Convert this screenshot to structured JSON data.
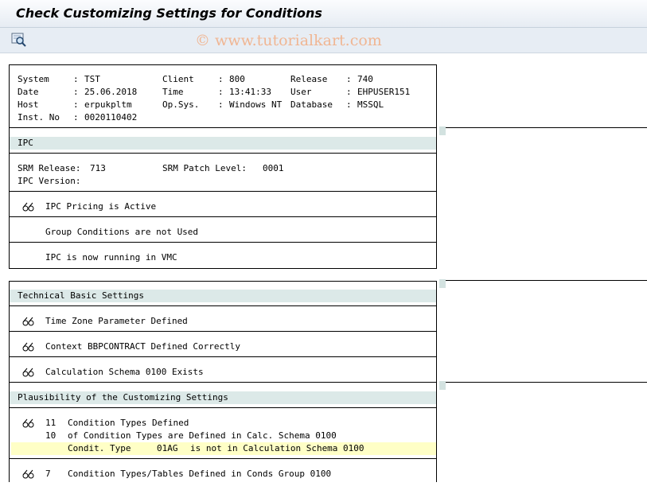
{
  "window": {
    "title": "Check Customizing Settings for Conditions",
    "watermark": "© www.tutorialkart.com"
  },
  "toolbar": {
    "inspect_icon": "magnifier-icon"
  },
  "system_info": {
    "system_label": "System",
    "system_value": "TST",
    "client_label": "Client",
    "client_value": "800",
    "release_label": "Release",
    "release_value": "740",
    "date_label": "Date",
    "date_value": "25.06.2018",
    "time_label": "Time",
    "time_value": "13:41:33",
    "user_label": "User",
    "user_value": "EHPUSER151",
    "host_label": "Host",
    "host_value": "erpukpltm",
    "opsys_label": "Op.Sys.",
    "opsys_value": "Windows NT",
    "database_label": "Database",
    "database_value": "MSSQL",
    "instno_label": "Inst. No",
    "instno_value": "0020110402",
    "colon": ":"
  },
  "ipc": {
    "heading": "IPC",
    "srm_release_label": "SRM Release:",
    "srm_release_value": "713",
    "srm_patch_label": "SRM Patch Level:",
    "srm_patch_value": "0001",
    "ipc_version_label": "IPC Version:",
    "messages": [
      {
        "text": "IPC Pricing is Active",
        "icon": "glasses-icon"
      },
      {
        "text": "Group Conditions are not Used",
        "icon": ""
      },
      {
        "text": "IPC is now running in VMC",
        "icon": ""
      }
    ]
  },
  "technical": {
    "heading": "Technical Basic Settings",
    "messages": [
      {
        "text": "Time Zone Parameter Defined",
        "icon": "glasses-icon"
      },
      {
        "text": "Context BBPCONTRACT Defined Correctly",
        "icon": "glasses-icon"
      },
      {
        "text": "Calculation Schema 0100 Exists",
        "icon": "glasses-icon"
      }
    ]
  },
  "plausibility": {
    "heading": "Plausibility of the Customizing Settings",
    "line1_count": "11",
    "line1_text": "Condition Types Defined",
    "line2_count": "10",
    "line2_text": "of Condition Types are Defined in Calc. Schema 0100",
    "line3_label": "Condit. Type",
    "line3_value": "01AG",
    "line3_text": "is not in Calculation Schema 0100",
    "line4_count": "7",
    "line4_text": "Condition Types/Tables Defined in Conds Group 0100"
  },
  "colors": {
    "band": "#dce9e8",
    "highlight": "#ffffc6",
    "watermark": "#f0b693"
  }
}
